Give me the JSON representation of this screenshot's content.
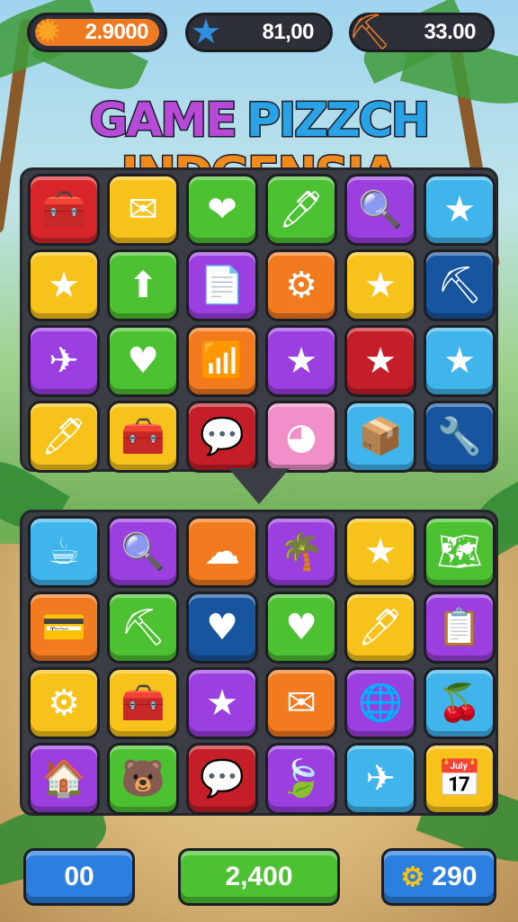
{
  "hud": {
    "coins": {
      "icon": "orange-star-badge-icon",
      "value": "2.9000",
      "color": "#f07a22"
    },
    "stars": {
      "icon": "blue-star-icon",
      "value": "81,00",
      "color": "#2d3038"
    },
    "tools": {
      "icon": "pickaxe-icon",
      "value": "33.00",
      "color": "#2d3038"
    }
  },
  "title": {
    "words": [
      "GAME",
      "PIZZCH",
      "INDGENSIA"
    ],
    "colors": [
      "#b84ad8",
      "#2aa3e6",
      "#f08a1c"
    ]
  },
  "upper_board": {
    "tiles": [
      {
        "icon": "toolbox-icon",
        "glyph": "🧰",
        "color": "#d8262b"
      },
      {
        "icon": "envelope-icon",
        "glyph": "✉",
        "color": "#f7c21a"
      },
      {
        "icon": "heart-icon",
        "glyph": "❤",
        "color": "#4cc232"
      },
      {
        "icon": "pen-icon",
        "glyph": "🖊",
        "color": "#4cc232"
      },
      {
        "icon": "magnifier-icon",
        "glyph": "🔍",
        "color": "#9b3fe0"
      },
      {
        "icon": "star-icon",
        "glyph": "★",
        "color": "#3fb5ec"
      },
      {
        "icon": "star-icon",
        "glyph": "★",
        "color": "#f7c21a"
      },
      {
        "icon": "arrow-up-icon",
        "glyph": "⬆",
        "color": "#4cc232"
      },
      {
        "icon": "document-icon",
        "glyph": "📄",
        "color": "#9b3fe0"
      },
      {
        "icon": "gear-icon",
        "glyph": "⚙",
        "color": "#f27a1f"
      },
      {
        "icon": "star-icon",
        "glyph": "★",
        "color": "#f7c21a"
      },
      {
        "icon": "pickaxe-icon",
        "glyph": "⛏",
        "color": "#17559e"
      },
      {
        "icon": "paper-plane-icon",
        "glyph": "✈",
        "color": "#9b3fe0"
      },
      {
        "icon": "heart-icon",
        "glyph": "♥",
        "color": "#4cc232"
      },
      {
        "icon": "bar-chart-icon",
        "glyph": "📶",
        "color": "#f27a1f"
      },
      {
        "icon": "star-icon",
        "glyph": "★",
        "color": "#9b3fe0"
      },
      {
        "icon": "star-icon",
        "glyph": "★",
        "color": "#c41e28"
      },
      {
        "icon": "star-icon",
        "glyph": "★",
        "color": "#3fb5ec"
      },
      {
        "icon": "pen-icon",
        "glyph": "🖊",
        "color": "#f7c21a"
      },
      {
        "icon": "toolbox-icon",
        "glyph": "🧰",
        "color": "#f7c21a"
      },
      {
        "icon": "chat-bubble-icon",
        "glyph": "💬",
        "color": "#c41e28"
      },
      {
        "icon": "beach-ball-icon",
        "glyph": "◕",
        "color": "#f08fc8"
      },
      {
        "icon": "box-icon",
        "glyph": "📦",
        "color": "#3fb5ec"
      },
      {
        "icon": "wrench-icon",
        "glyph": "🔧",
        "color": "#17559e"
      }
    ]
  },
  "lower_board": {
    "tiles": [
      {
        "icon": "kettle-icon",
        "glyph": "☕",
        "color": "#3fb5ec"
      },
      {
        "icon": "magnifier-icon",
        "glyph": "🔍",
        "color": "#9b3fe0"
      },
      {
        "icon": "cloud-face-icon",
        "glyph": "☁",
        "color": "#f27a1f"
      },
      {
        "icon": "palm-tree-icon",
        "glyph": "🌴",
        "color": "#9b3fe0"
      },
      {
        "icon": "star-icon",
        "glyph": "★",
        "color": "#f7c21a"
      },
      {
        "icon": "map-icon",
        "glyph": "🗺",
        "color": "#4cc232"
      },
      {
        "icon": "card-icon",
        "glyph": "💳",
        "color": "#f27a1f"
      },
      {
        "icon": "pickaxe-icon",
        "glyph": "⛏",
        "color": "#4cc232"
      },
      {
        "icon": "heart-icon",
        "glyph": "♥",
        "color": "#17559e"
      },
      {
        "icon": "heart-icon",
        "glyph": "♥",
        "color": "#4cc232"
      },
      {
        "icon": "pen-icon",
        "glyph": "🖊",
        "color": "#f7c21a"
      },
      {
        "icon": "clipboard-icon",
        "glyph": "📋",
        "color": "#9b3fe0"
      },
      {
        "icon": "gear-icon",
        "glyph": "⚙",
        "color": "#f7c21a"
      },
      {
        "icon": "toolbox-icon",
        "glyph": "🧰",
        "color": "#f7c21a"
      },
      {
        "icon": "star-icon",
        "glyph": "★",
        "color": "#9b3fe0"
      },
      {
        "icon": "envelope-icon",
        "glyph": "✉",
        "color": "#f27a1f"
      },
      {
        "icon": "globe-icon",
        "glyph": "🌐",
        "color": "#9b3fe0"
      },
      {
        "icon": "cherry-icon",
        "glyph": "🍒",
        "color": "#3fb5ec"
      },
      {
        "icon": "house-icon",
        "glyph": "🏠",
        "color": "#9b3fe0"
      },
      {
        "icon": "bear-face-icon",
        "glyph": "🐻",
        "color": "#4cc232"
      },
      {
        "icon": "chat-heart-icon",
        "glyph": "💬",
        "color": "#c41e28"
      },
      {
        "icon": "leaf-icon",
        "glyph": "🍃",
        "color": "#9b3fe0"
      },
      {
        "icon": "paper-plane-icon",
        "glyph": "✈",
        "color": "#3fb5ec"
      },
      {
        "icon": "calendar-icon",
        "glyph": "📅",
        "color": "#f7c21a"
      }
    ]
  },
  "footer": {
    "left": {
      "value": "00",
      "color": "#2a7fe0"
    },
    "center": {
      "value": "2,400",
      "color": "#4cc232"
    },
    "right": {
      "icon": "gear-icon",
      "value": "290",
      "color": "#2a7fe0"
    }
  }
}
